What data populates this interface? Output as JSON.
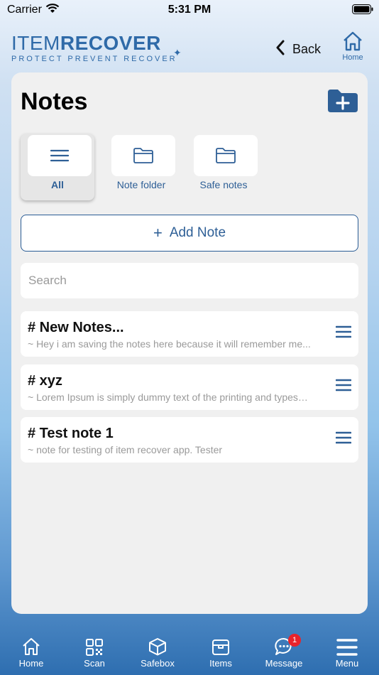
{
  "status": {
    "carrier": "Carrier",
    "time": "5:31 PM"
  },
  "header": {
    "logo_light": "ITEM",
    "logo_bold": "RECOVER",
    "tagline": "PROTECT  PREVENT  RECOVER",
    "back_label": "Back",
    "home_label": "Home"
  },
  "page": {
    "title": "Notes"
  },
  "categories": [
    {
      "label": "All",
      "icon": "menu-icon",
      "active": true
    },
    {
      "label": "Note folder",
      "icon": "folder-icon",
      "active": false
    },
    {
      "label": "Safe notes",
      "icon": "folder-icon",
      "active": false
    }
  ],
  "add_note": {
    "plus": "+",
    "label": "Add Note"
  },
  "search": {
    "placeholder": "Search",
    "value": ""
  },
  "notes": [
    {
      "title": "# New Notes...",
      "preview": "~ Hey i am saving the notes here because it will remember me..."
    },
    {
      "title": "# xyz",
      "preview": "~ Lorem Ipsum is simply dummy text of the printing and typesetting"
    },
    {
      "title": "# Test note 1",
      "preview": "~ note for testing of item recover app. Tester"
    }
  ],
  "tabs": [
    {
      "label": "Home",
      "icon": "home-icon"
    },
    {
      "label": "Scan",
      "icon": "qr-code-icon"
    },
    {
      "label": "Safebox",
      "icon": "box-icon"
    },
    {
      "label": "Items",
      "icon": "package-icon"
    },
    {
      "label": "Message",
      "icon": "chat-icon",
      "badge": "1"
    },
    {
      "label": "Menu",
      "icon": "menu-icon"
    }
  ],
  "colors": {
    "accent": "#2e5f96",
    "brand": "#2f6aa8",
    "badge": "#e8232a",
    "card": "#f0f0f0"
  }
}
